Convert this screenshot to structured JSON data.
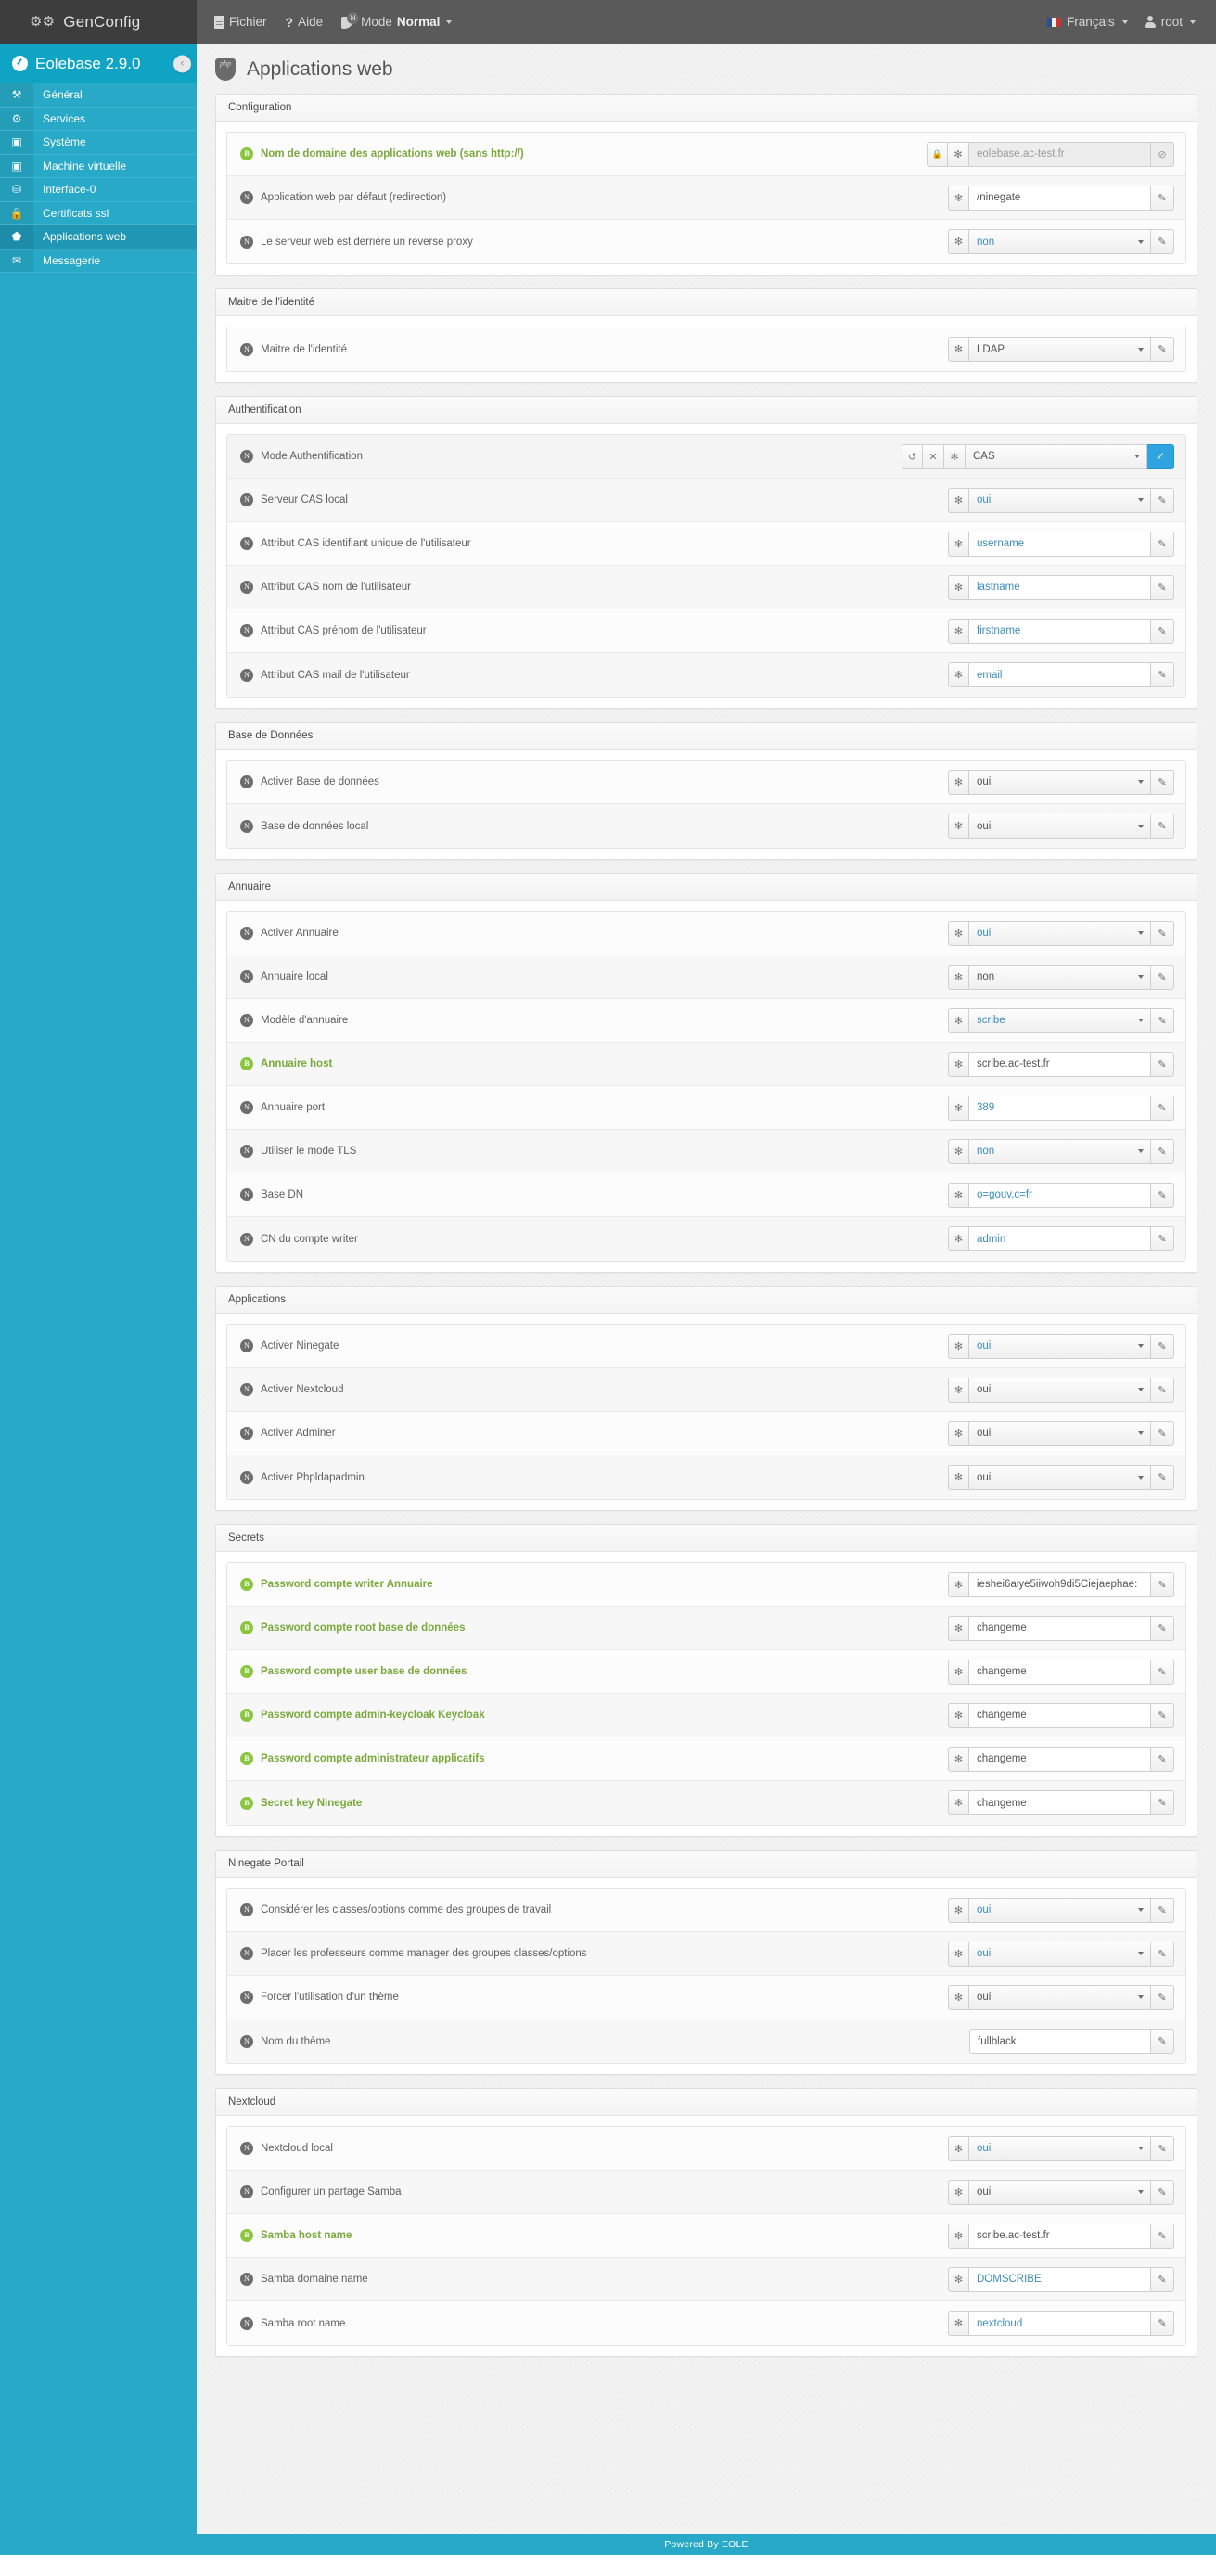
{
  "topbar": {
    "brand": "GenConfig",
    "menu": [
      {
        "label": "Fichier",
        "icon": "document-icon"
      },
      {
        "label": "Aide",
        "icon": "question-icon"
      }
    ],
    "mode": {
      "prefix": "Mode",
      "value": "Normal",
      "badge": "N",
      "icon": "tag-icon"
    },
    "language": "Français",
    "user": "root"
  },
  "sidebar": {
    "title": "Eolebase 2.9.0",
    "collapse": "‹",
    "items": [
      {
        "label": "Général",
        "icon": "wrench-icon",
        "active": false
      },
      {
        "label": "Services",
        "icon": "gears-icon",
        "active": false
      },
      {
        "label": "Système",
        "icon": "monitor-icon",
        "active": false
      },
      {
        "label": "Machine virtuelle",
        "icon": "monitor-icon",
        "active": false
      },
      {
        "label": "Interface-0",
        "icon": "network-icon",
        "active": false
      },
      {
        "label": "Certificats ssl",
        "icon": "lock-icon",
        "active": false
      },
      {
        "label": "Applications web",
        "icon": "php-shield-icon",
        "active": true
      },
      {
        "label": "Messagerie",
        "icon": "envelope-icon",
        "active": false
      }
    ]
  },
  "page": {
    "title": "Applications web",
    "icon": "php-shield-icon"
  },
  "footer": {
    "text": "Powered By EOLE"
  },
  "sections": [
    {
      "title": "Configuration",
      "rows": [
        {
          "label": "Nom de domaine des applications web (sans http://)",
          "badge": "B",
          "green": true,
          "type": "text",
          "value": "eolebase.ac-test.fr",
          "locked": true,
          "disabled": true,
          "blue": false
        },
        {
          "label": "Application web par défaut (redirection)",
          "badge": "N",
          "green": false,
          "type": "text",
          "value": "/ninegate",
          "blue": false
        },
        {
          "label": "Le serveur web est derrière un reverse proxy",
          "badge": "N",
          "green": false,
          "type": "select",
          "value": "non",
          "blue": true
        }
      ]
    },
    {
      "title": "Maitre de l'identité",
      "rows": [
        {
          "label": "Maitre de l'identité",
          "badge": "N",
          "green": false,
          "type": "select",
          "value": "LDAP",
          "blue": false
        }
      ]
    },
    {
      "title": "Authentification",
      "rows": [
        {
          "label": "Mode Authentification",
          "badge": "N",
          "green": false,
          "type": "select",
          "value": "CAS",
          "blue": false,
          "editing": true,
          "revert": "↺",
          "cancel": "✕",
          "confirm": "✓"
        },
        {
          "label": "Serveur CAS local",
          "badge": "N",
          "green": false,
          "type": "select",
          "value": "oui",
          "blue": true
        },
        {
          "label": "Attribut CAS identifiant unique de l'utilisateur",
          "badge": "N",
          "green": false,
          "type": "text",
          "value": "username",
          "blue": true
        },
        {
          "label": "Attribut CAS nom de l'utilisateur",
          "badge": "N",
          "green": false,
          "type": "text",
          "value": "lastname",
          "blue": true
        },
        {
          "label": "Attribut CAS prénom de l'utilisateur",
          "badge": "N",
          "green": false,
          "type": "text",
          "value": "firstname",
          "blue": true
        },
        {
          "label": "Attribut CAS mail de l'utilisateur",
          "badge": "N",
          "green": false,
          "type": "text",
          "value": "email",
          "blue": true
        }
      ]
    },
    {
      "title": "Base de Données",
      "rows": [
        {
          "label": "Activer Base de données",
          "badge": "N",
          "green": false,
          "type": "select",
          "value": "oui",
          "blue": false
        },
        {
          "label": "Base de données local",
          "badge": "N",
          "green": false,
          "type": "select",
          "value": "oui",
          "blue": false
        }
      ]
    },
    {
      "title": "Annuaire",
      "rows": [
        {
          "label": "Activer Annuaire",
          "badge": "N",
          "green": false,
          "type": "select",
          "value": "oui",
          "blue": true
        },
        {
          "label": "Annuaire local",
          "badge": "N",
          "green": false,
          "type": "select",
          "value": "non",
          "blue": false
        },
        {
          "label": "Modèle d'annuaire",
          "badge": "N",
          "green": false,
          "type": "select",
          "value": "scribe",
          "blue": true
        },
        {
          "label": "Annuaire host",
          "badge": "B",
          "green": true,
          "type": "text",
          "value": "scribe.ac-test.fr",
          "blue": false
        },
        {
          "label": "Annuaire port",
          "badge": "N",
          "green": false,
          "type": "text",
          "value": "389",
          "blue": true
        },
        {
          "label": "Utiliser le mode TLS",
          "badge": "N",
          "green": false,
          "type": "select",
          "value": "non",
          "blue": true
        },
        {
          "label": "Base DN",
          "badge": "N",
          "green": false,
          "type": "text",
          "value": "o=gouv,c=fr",
          "blue": true
        },
        {
          "label": "CN du compte writer",
          "badge": "N",
          "green": false,
          "type": "text",
          "value": "admin",
          "blue": true
        }
      ]
    },
    {
      "title": "Applications",
      "rows": [
        {
          "label": "Activer Ninegate",
          "badge": "N",
          "green": false,
          "type": "select",
          "value": "oui",
          "blue": true
        },
        {
          "label": "Activer Nextcloud",
          "badge": "N",
          "green": false,
          "type": "select",
          "value": "oui",
          "blue": false
        },
        {
          "label": "Activer Adminer",
          "badge": "N",
          "green": false,
          "type": "select",
          "value": "oui",
          "blue": false
        },
        {
          "label": "Activer Phpldapadmin",
          "badge": "N",
          "green": false,
          "type": "select",
          "value": "oui",
          "blue": false
        }
      ]
    },
    {
      "title": "Secrets",
      "rows": [
        {
          "label": "Password compte writer Annuaire",
          "badge": "B",
          "green": true,
          "type": "text",
          "value": "ieshei6aiye5iiwoh9di5Ciejaephae:",
          "blue": false
        },
        {
          "label": "Password compte root base de données",
          "badge": "B",
          "green": true,
          "type": "text",
          "value": "changeme",
          "blue": false
        },
        {
          "label": "Password compte user base de données",
          "badge": "B",
          "green": true,
          "type": "text",
          "value": "changeme",
          "blue": false
        },
        {
          "label": "Password compte admin-keycloak Keycloak",
          "badge": "B",
          "green": true,
          "type": "text",
          "value": "changeme",
          "blue": false
        },
        {
          "label": "Password compte administrateur applicatifs",
          "badge": "B",
          "green": true,
          "type": "text",
          "value": "changeme",
          "blue": false
        },
        {
          "label": "Secret key Ninegate",
          "badge": "B",
          "green": true,
          "type": "text",
          "value": "changeme",
          "blue": false
        }
      ]
    },
    {
      "title": "Ninegate Portail",
      "rows": [
        {
          "label": "Considérer les classes/options comme des groupes de travail",
          "badge": "N",
          "green": false,
          "type": "select",
          "value": "oui",
          "blue": true
        },
        {
          "label": "Placer les professeurs comme manager des groupes classes/options",
          "badge": "N",
          "green": false,
          "type": "select",
          "value": "oui",
          "blue": true
        },
        {
          "label": "Forcer l'utilisation d'un thème",
          "badge": "N",
          "green": false,
          "type": "select",
          "value": "oui",
          "blue": false
        },
        {
          "label": "Nom du thème",
          "badge": "N",
          "green": false,
          "type": "text",
          "value": "fullblack",
          "blue": false,
          "nostar": true
        }
      ]
    },
    {
      "title": "Nextcloud",
      "rows": [
        {
          "label": "Nextcloud local",
          "badge": "N",
          "green": false,
          "type": "select",
          "value": "oui",
          "blue": true
        },
        {
          "label": "Configurer un partage Samba",
          "badge": "N",
          "green": false,
          "type": "select",
          "value": "oui",
          "blue": false
        },
        {
          "label": "Samba host name",
          "badge": "B",
          "green": true,
          "type": "text",
          "value": "scribe.ac-test.fr",
          "blue": false
        },
        {
          "label": "Samba domaine name",
          "badge": "N",
          "green": false,
          "type": "text",
          "value": "DOMSCRIBE",
          "blue": true
        },
        {
          "label": "Samba root name",
          "badge": "N",
          "green": false,
          "type": "text",
          "value": "nextcloud",
          "blue": true
        }
      ]
    }
  ],
  "icons": {
    "star": "✻",
    "edit": "✇",
    "lock": "🔒",
    "blocked": "⊘",
    "wrench": "🔧",
    "gears": "⚙",
    "monitor": "🖥",
    "network": "⛁",
    "padlock": "🔒",
    "envelope": "✉",
    "question": "?"
  }
}
